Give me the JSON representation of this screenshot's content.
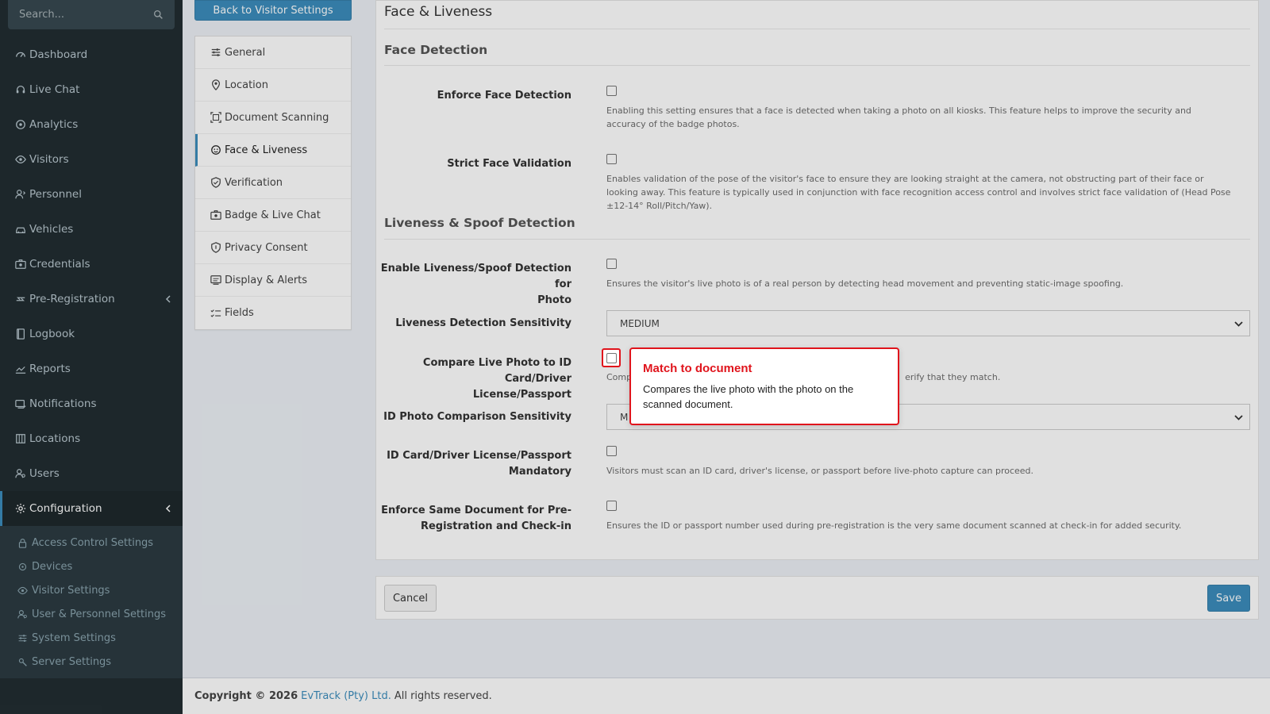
{
  "sidebar": {
    "search_placeholder": "Search...",
    "items": [
      {
        "label": "Dashboard",
        "icon": "gauge-icon"
      },
      {
        "label": "Live Chat",
        "icon": "headset-icon"
      },
      {
        "label": "Analytics",
        "icon": "target-icon"
      },
      {
        "label": "Visitors",
        "icon": "eye-icon"
      },
      {
        "label": "Personnel",
        "icon": "user-icon"
      },
      {
        "label": "Vehicles",
        "icon": "car-icon"
      },
      {
        "label": "Credentials",
        "icon": "id-card-icon"
      },
      {
        "label": "Pre-Registration",
        "icon": "arrows-icon"
      },
      {
        "label": "Logbook",
        "icon": "book-icon"
      },
      {
        "label": "Reports",
        "icon": "chart-icon"
      },
      {
        "label": "Notifications",
        "icon": "bell-icon"
      },
      {
        "label": "Locations",
        "icon": "building-icon"
      },
      {
        "label": "Users",
        "icon": "users-icon"
      },
      {
        "label": "Configuration",
        "icon": "gear-icon"
      }
    ],
    "submenu": [
      {
        "label": "Access Control Settings",
        "icon": "lock-icon"
      },
      {
        "label": "Devices",
        "icon": "device-icon"
      },
      {
        "label": "Visitor Settings",
        "icon": "eye-icon"
      },
      {
        "label": "User & Personnel Settings",
        "icon": "users-icon"
      },
      {
        "label": "System Settings",
        "icon": "sliders-icon"
      },
      {
        "label": "Server Settings",
        "icon": "server-icon"
      }
    ]
  },
  "back_button": "Back to Visitor Settings",
  "subnav": [
    {
      "label": "General"
    },
    {
      "label": "Location"
    },
    {
      "label": "Document Scanning"
    },
    {
      "label": "Face & Liveness"
    },
    {
      "label": "Verification"
    },
    {
      "label": "Badge & Live Chat"
    },
    {
      "label": "Privacy Consent"
    },
    {
      "label": "Display & Alerts"
    },
    {
      "label": "Fields"
    }
  ],
  "panel": {
    "title": "Face & Liveness",
    "face_detection_title": "Face Detection",
    "liveness_title": "Liveness & Spoof Detection",
    "enforce_face": {
      "label": "Enforce Face Detection",
      "help": "Enabling this setting ensures that a face is detected when taking a photo on all kiosks. This feature helps to improve the security and accuracy of the badge photos."
    },
    "strict_face": {
      "label": "Strict Face Validation",
      "help": "Enables validation of the pose of the visitor's face to ensure they are looking straight at the camera, not obstructing part of their face or looking away. This feature is typically used in conjunction with face recognition access control and involves strict face validation of (Head Pose ±12-14° Roll/Pitch/Yaw)."
    },
    "liveness_enable": {
      "label_line1": "Enable Liveness/Spoof Detection for",
      "label_line2": "Photo",
      "help": "Ensures the visitor's live photo is of a real person by detecting head movement and preventing static-image spoofing."
    },
    "liveness_sensitivity": {
      "label": "Liveness Detection Sensitivity",
      "value": "MEDIUM"
    },
    "compare_photo": {
      "label_line1": "Compare Live Photo to ID Card/Driver",
      "label_line2": "License/Passport",
      "help_start": "Comp",
      "help_end": "erify that they match."
    },
    "id_sensitivity": {
      "label": "ID Photo Comparison Sensitivity",
      "value_fragment": "M"
    },
    "id_mandatory": {
      "label_line1": "ID Card/Driver License/Passport",
      "label_line2": "Mandatory",
      "help": "Visitors must scan an ID card, driver's license, or passport before live-photo capture can proceed."
    },
    "same_document": {
      "label_line1": "Enforce Same Document for Pre-",
      "label_line2": "Registration and Check-in",
      "help": "Ensures the ID or passport number used during pre-registration is the very same document scanned at check-in for added security."
    }
  },
  "tooltip": {
    "title": "Match to document",
    "body": "Compares the live photo with the photo on the scanned document."
  },
  "buttons": {
    "cancel": "Cancel",
    "save": "Save"
  },
  "footer": {
    "copyright": "Copyright © 2026",
    "company": "EvTrack (Pty) Ltd.",
    "rights": "All rights reserved."
  },
  "colors": {
    "sidebar_bg": "#222d32",
    "accent": "#3c8dbc",
    "highlight": "#e0141c"
  }
}
